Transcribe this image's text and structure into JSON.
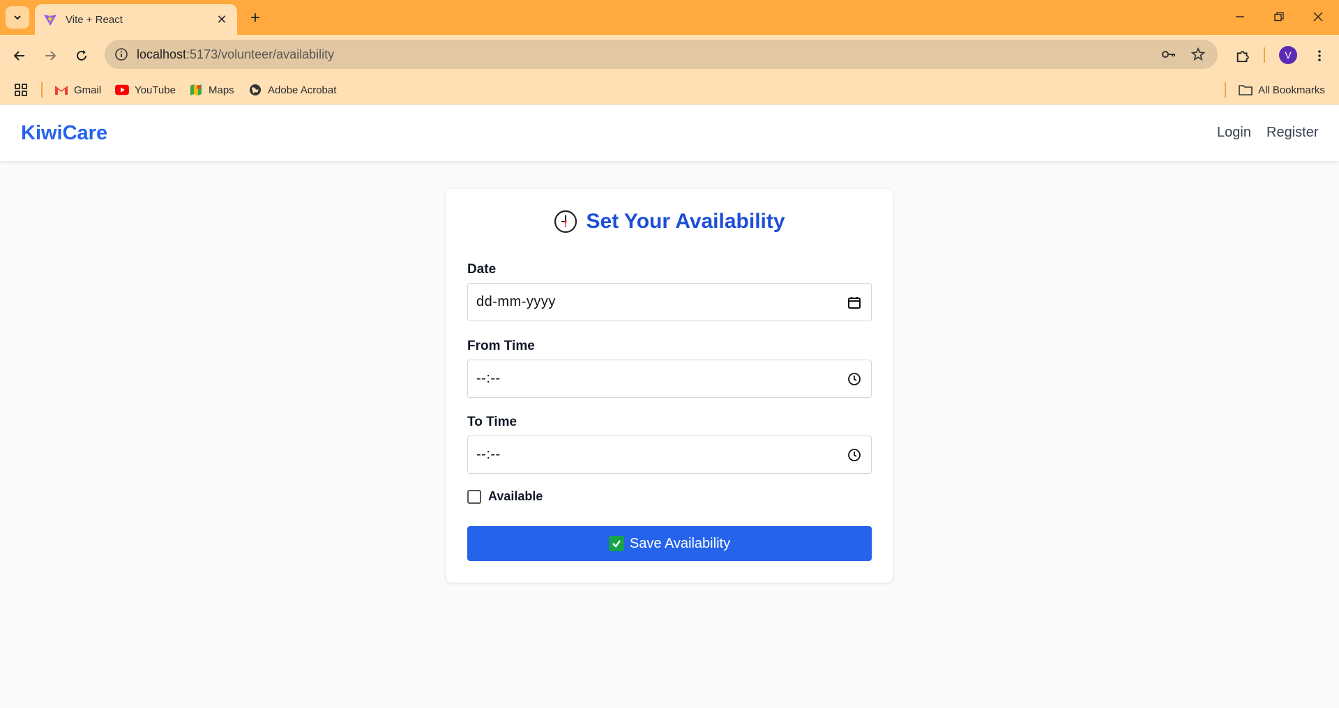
{
  "browser": {
    "tab_title": "Vite + React",
    "url_host": "localhost",
    "url_path": ":5173/volunteer/availability",
    "avatar_letter": "V",
    "bookmarks": [
      "Gmail",
      "YouTube",
      "Maps",
      "Adobe Acrobat"
    ],
    "all_bookmarks": "All Bookmarks"
  },
  "app": {
    "brand": "KiwiCare",
    "nav": {
      "login": "Login",
      "register": "Register"
    },
    "brand_color": "#2563eb"
  },
  "form": {
    "title": "Set Your Availability",
    "date_label": "Date",
    "date_value": "dd-mm-yyyy",
    "from_label": "From Time",
    "from_value": "--:--",
    "to_label": "To Time",
    "to_value": "--:--",
    "available_label": "Available",
    "available_checked": false,
    "save_label": "Save Availability"
  }
}
